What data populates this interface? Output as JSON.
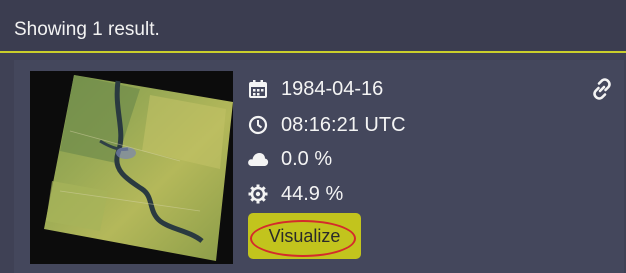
{
  "header": {
    "results_text": "Showing 1 result."
  },
  "result": {
    "date": "1984-04-16",
    "time": "08:16:21 UTC",
    "cloud_cover": "0.0 %",
    "quality": "44.9 %",
    "visualize_label": "Visualize"
  },
  "icons": {
    "date": "calendar-icon",
    "time": "clock-icon",
    "cloud": "cloud-icon",
    "quality": "gear-icon",
    "link": "link-icon"
  },
  "colors": {
    "background": "#3f4155",
    "accent": "#c9cd2b",
    "button": "#c2c41d",
    "highlight_ring": "#d42b2b"
  }
}
